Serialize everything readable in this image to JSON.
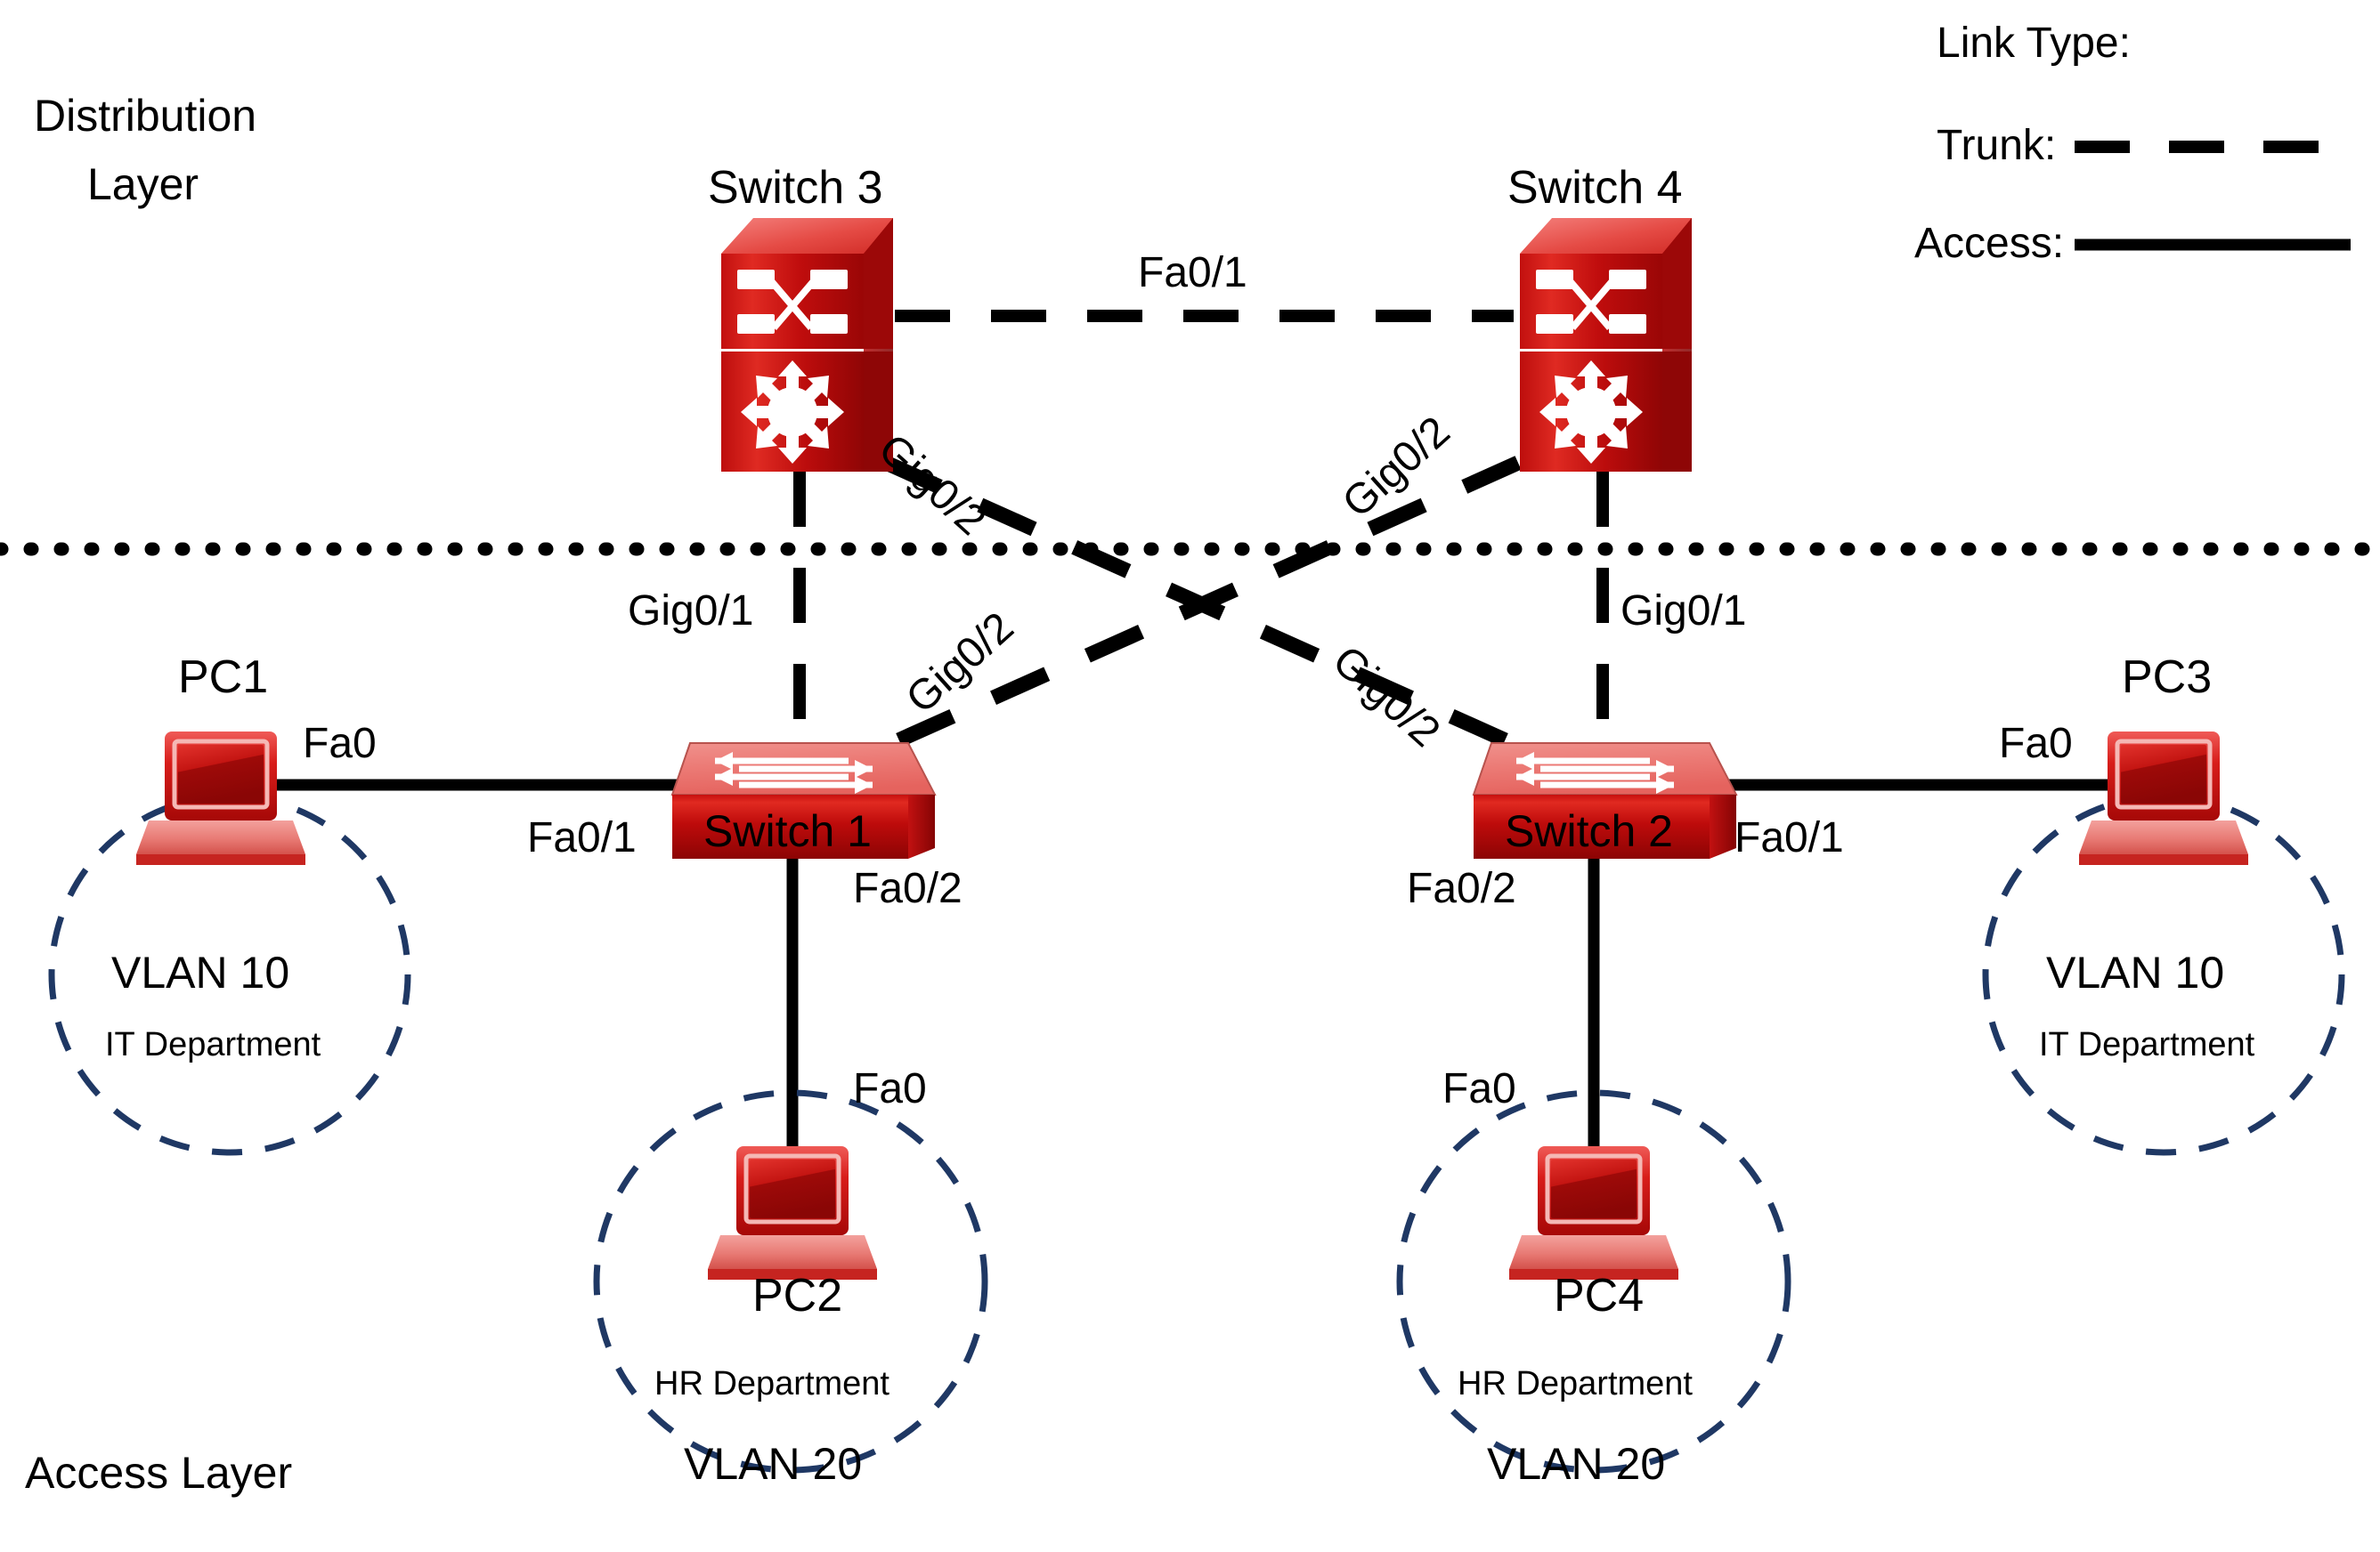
{
  "diagram": {
    "title_layers": {
      "distribution_line1": "Distribution",
      "distribution_line2": "Layer",
      "access": "Access Layer"
    },
    "legend": {
      "title": "Link Type:",
      "trunk_label": "Trunk:",
      "access_label": "Access:",
      "trunk_style": "dashed",
      "access_style": "solid",
      "line_color": "#000000"
    },
    "colors": {
      "device_red": "#CC0000",
      "device_red_light": "#E8332F",
      "device_red_dark": "#A10000",
      "vlan_circle": "#1F3864",
      "link": "#000000",
      "separator": "#000000"
    },
    "devices": [
      {
        "id": "switch3",
        "label": "Switch 3",
        "type": "multilayer-switch-icon",
        "layer": "distribution"
      },
      {
        "id": "switch4",
        "label": "Switch 4",
        "type": "multilayer-switch-icon",
        "layer": "distribution"
      },
      {
        "id": "switch1",
        "label": "Switch 1",
        "type": "switch-icon",
        "layer": "access"
      },
      {
        "id": "switch2",
        "label": "Switch 2",
        "type": "switch-icon",
        "layer": "access"
      },
      {
        "id": "pc1",
        "label": "PC1",
        "type": "laptop-icon"
      },
      {
        "id": "pc2",
        "label": "PC2",
        "type": "laptop-icon"
      },
      {
        "id": "pc3",
        "label": "PC3",
        "type": "laptop-icon"
      },
      {
        "id": "pc4",
        "label": "PC4",
        "type": "laptop-icon"
      }
    ],
    "port_labels": {
      "sw3_sw4_trunk": "Fa0/1",
      "sw3_sw1_gig01": "Gig0/1",
      "sw4_sw2_gig01": "Gig0/1",
      "sw3_cross_top": "Gig0/2",
      "sw4_cross_top": "Gig0/2",
      "sw1_cross_bottom": "Gig0/2",
      "sw2_cross_bottom": "Gig0/2",
      "pc1_fa0": "Fa0",
      "pc3_fa0": "Fa0",
      "pc2_fa0": "Fa0",
      "pc4_fa0": "Fa0",
      "sw1_fa01": "Fa0/1",
      "sw1_fa02": "Fa0/2",
      "sw2_fa01": "Fa0/1",
      "sw2_fa02": "Fa0/2"
    },
    "vlans": [
      {
        "id": "vlan10-left",
        "name": "VLAN 10",
        "dept": "IT Department",
        "order": "name-first"
      },
      {
        "id": "vlan10-right",
        "name": "VLAN 10",
        "dept": "IT Department",
        "order": "name-first"
      },
      {
        "id": "vlan20-left",
        "name": "VLAN 20",
        "dept": "HR Department",
        "order": "dept-first",
        "pc": "PC2"
      },
      {
        "id": "vlan20-right",
        "name": "VLAN 20",
        "dept": "HR Department",
        "order": "dept-first",
        "pc": "PC4"
      }
    ]
  }
}
